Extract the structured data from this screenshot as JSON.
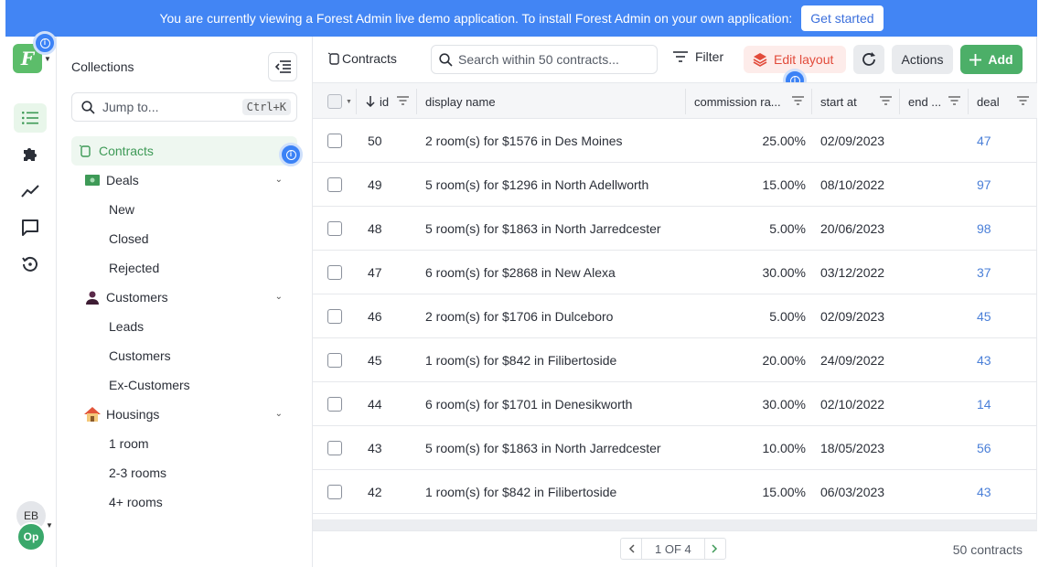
{
  "banner": {
    "message": "You are currently viewing a Forest Admin live demo application. To install Forest Admin on your own application:",
    "cta": "Get started"
  },
  "rail": {
    "logo_letter": "F",
    "user_initials": "EB",
    "project_initials": "Op",
    "icons": [
      "list-icon",
      "puzzle-icon",
      "trend-icon",
      "chat-icon",
      "history-icon"
    ]
  },
  "sidebar": {
    "title": "Collections",
    "jump_placeholder": "Jump to...",
    "jump_shortcut": "Ctrl+K",
    "items": [
      {
        "label": "Contracts",
        "active": true
      },
      {
        "label": "Deals",
        "subs": [
          "New",
          "Closed",
          "Rejected"
        ]
      },
      {
        "label": "Customers",
        "subs": [
          "Leads",
          "Customers",
          "Ex-Customers"
        ]
      },
      {
        "label": "Housings",
        "subs": [
          "1 room",
          "2-3 rooms",
          "4+ rooms"
        ]
      }
    ]
  },
  "toolbar": {
    "title": "Contracts",
    "search_placeholder": "Search within 50 contracts...",
    "filter_label": "Filter",
    "edit_layout_label": "Edit layout",
    "actions_label": "Actions",
    "add_label": "Add"
  },
  "table": {
    "columns": [
      "id",
      "display name",
      "commission ra...",
      "start at",
      "end ...",
      "deal"
    ],
    "rows": [
      {
        "id": "50",
        "name": "2 room(s) for $1576 in Des Moines",
        "commission": "25.00%",
        "start": "02/09/2023",
        "deal": "47"
      },
      {
        "id": "49",
        "name": "5 room(s) for $1296 in North Adellworth",
        "commission": "15.00%",
        "start": "08/10/2022",
        "deal": "97"
      },
      {
        "id": "48",
        "name": "5 room(s) for $1863 in North Jarredcester",
        "commission": "5.00%",
        "start": "20/06/2023",
        "deal": "98"
      },
      {
        "id": "47",
        "name": "6 room(s) for $2868 in New Alexa",
        "commission": "30.00%",
        "start": "03/12/2022",
        "deal": "37"
      },
      {
        "id": "46",
        "name": "2 room(s) for $1706 in Dulceboro",
        "commission": "5.00%",
        "start": "02/09/2023",
        "deal": "45"
      },
      {
        "id": "45",
        "name": "1 room(s) for $842 in Filibertoside",
        "commission": "20.00%",
        "start": "24/09/2022",
        "deal": "43"
      },
      {
        "id": "44",
        "name": "6 room(s) for $1701 in Denesikworth",
        "commission": "30.00%",
        "start": "02/10/2022",
        "deal": "14"
      },
      {
        "id": "43",
        "name": "5 room(s) for $1863 in North Jarredcester",
        "commission": "10.00%",
        "start": "18/05/2023",
        "deal": "56"
      },
      {
        "id": "42",
        "name": "1 room(s) for $842 in Filibertoside",
        "commission": "15.00%",
        "start": "06/03/2023",
        "deal": "43"
      }
    ]
  },
  "footer": {
    "page_label": "1 OF 4",
    "count_label": "50 contracts"
  },
  "colors": {
    "banner": "#4285f4",
    "brand_green": "#4caf68",
    "link": "#4a7fd8",
    "edit_layout": "#e24b3b"
  }
}
